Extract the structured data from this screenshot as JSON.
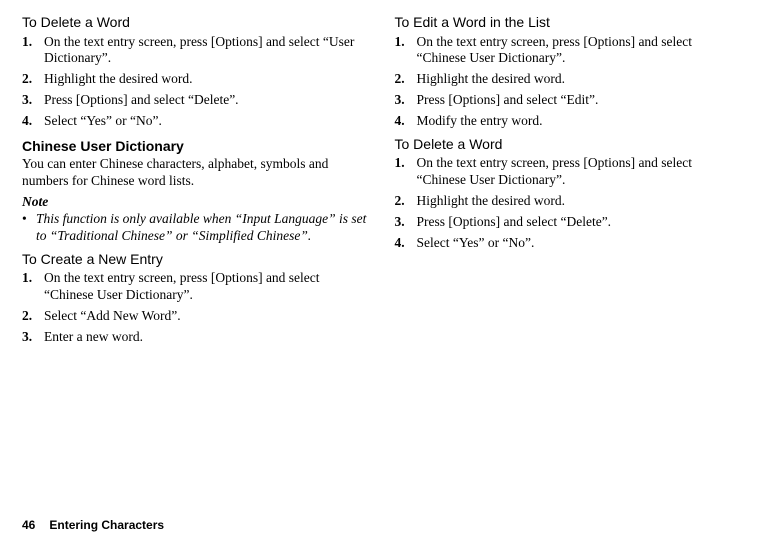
{
  "left": {
    "h_delete_word": "To Delete a Word",
    "delete_steps": [
      "On the text entry screen, press [Options] and select “User Dictionary”.",
      "Highlight the desired word.",
      "Press [Options] and select “Delete”.",
      "Select “Yes” or “No”."
    ],
    "h_chinese_dict": "Chinese User Dictionary",
    "chinese_intro": "You can enter Chinese characters, alphabet, symbols and numbers for Chinese word lists.",
    "note_label": "Note",
    "note_bullet": "•",
    "note_text": "This function is only available when “Input Language” is set to “Traditional Chinese” or “Simplified Chinese”.",
    "h_create_entry": "To Create a New Entry",
    "create_steps": [
      "On the text entry screen, press [Options] and select “Chinese User Dictionary”.",
      "Select “Add New Word”.",
      "Enter a new word."
    ]
  },
  "right": {
    "h_edit_word": "To Edit a Word in the List",
    "edit_steps": [
      "On the text entry screen, press [Options] and select “Chinese User Dictionary”.",
      "Highlight the desired word.",
      "Press [Options] and select “Edit”.",
      "Modify the entry word."
    ],
    "h_delete_word2": "To Delete a Word",
    "delete_steps2": [
      "On the text entry screen, press [Options] and select “Chinese User Dictionary”.",
      "Highlight the desired word.",
      "Press [Options] and select “Delete”.",
      "Select “Yes” or “No”."
    ]
  },
  "footer": {
    "page_num": "46",
    "section": "Entering Characters"
  }
}
